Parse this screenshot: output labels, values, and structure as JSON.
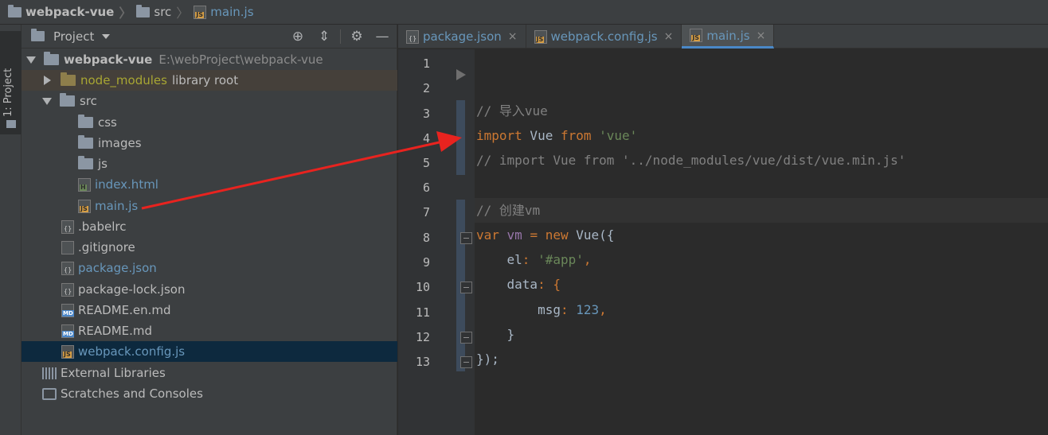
{
  "breadcrumb": {
    "project": "webpack-vue",
    "folder": "src",
    "file": "main.js"
  },
  "tool_strip": {
    "project_tab": "1: Project"
  },
  "panel": {
    "title": "Project",
    "icons": [
      "target-icon",
      "collapse-icon",
      "gear-icon",
      "minimize-icon"
    ]
  },
  "tree": [
    {
      "label": "webpack-vue",
      "extra": "E:\\webProject\\webpack-vue"
    },
    {
      "label": "node_modules",
      "extra": "library root"
    },
    {
      "label": "src"
    },
    {
      "label": "css"
    },
    {
      "label": "images"
    },
    {
      "label": "js"
    },
    {
      "label": "index.html"
    },
    {
      "label": "main.js"
    },
    {
      "label": ".babelrc"
    },
    {
      "label": ".gitignore"
    },
    {
      "label": "package.json"
    },
    {
      "label": "package-lock.json"
    },
    {
      "label": "README.en.md"
    },
    {
      "label": "README.md"
    },
    {
      "label": "webpack.config.js"
    },
    {
      "label": "External Libraries"
    },
    {
      "label": "Scratches and Consoles"
    }
  ],
  "tabs": [
    {
      "label": "package.json",
      "close": "×"
    },
    {
      "label": "webpack.config.js",
      "close": "×"
    },
    {
      "label": "main.js",
      "close": "×"
    }
  ],
  "editor": {
    "line_numbers": [
      "1",
      "2",
      "3",
      "4",
      "5",
      "6",
      "7",
      "8",
      "9",
      "10",
      "11",
      "12",
      "13"
    ],
    "code": {
      "l3": "// 导入vue",
      "l4_kw1": "import",
      "l4_id": " Vue ",
      "l4_kw2": "from",
      "l4_str": " 'vue'",
      "l5": "// import Vue from '../node_modules/vue/dist/vue.min.js'",
      "l7": "// 创建vm",
      "l8_kw": "var",
      "l8_id": " vm ",
      "l8_op": "=",
      "l8_kw2": " new",
      "l8_rest": " Vue({",
      "l9_prop": "    el",
      "l9_colon": ": ",
      "l9_str": "'#app'",
      "l9_end": ",",
      "l10_prop": "    data",
      "l10_colon": ": {",
      "l11_prop": "        msg",
      "l11_colon": ": ",
      "l11_num": "123",
      "l11_end": ",",
      "l12": "    }",
      "l13": "});"
    }
  },
  "colors": {
    "arrow": "#e8231f",
    "keyword": "#cc7832",
    "string": "#6a8759",
    "comment": "#808080"
  }
}
